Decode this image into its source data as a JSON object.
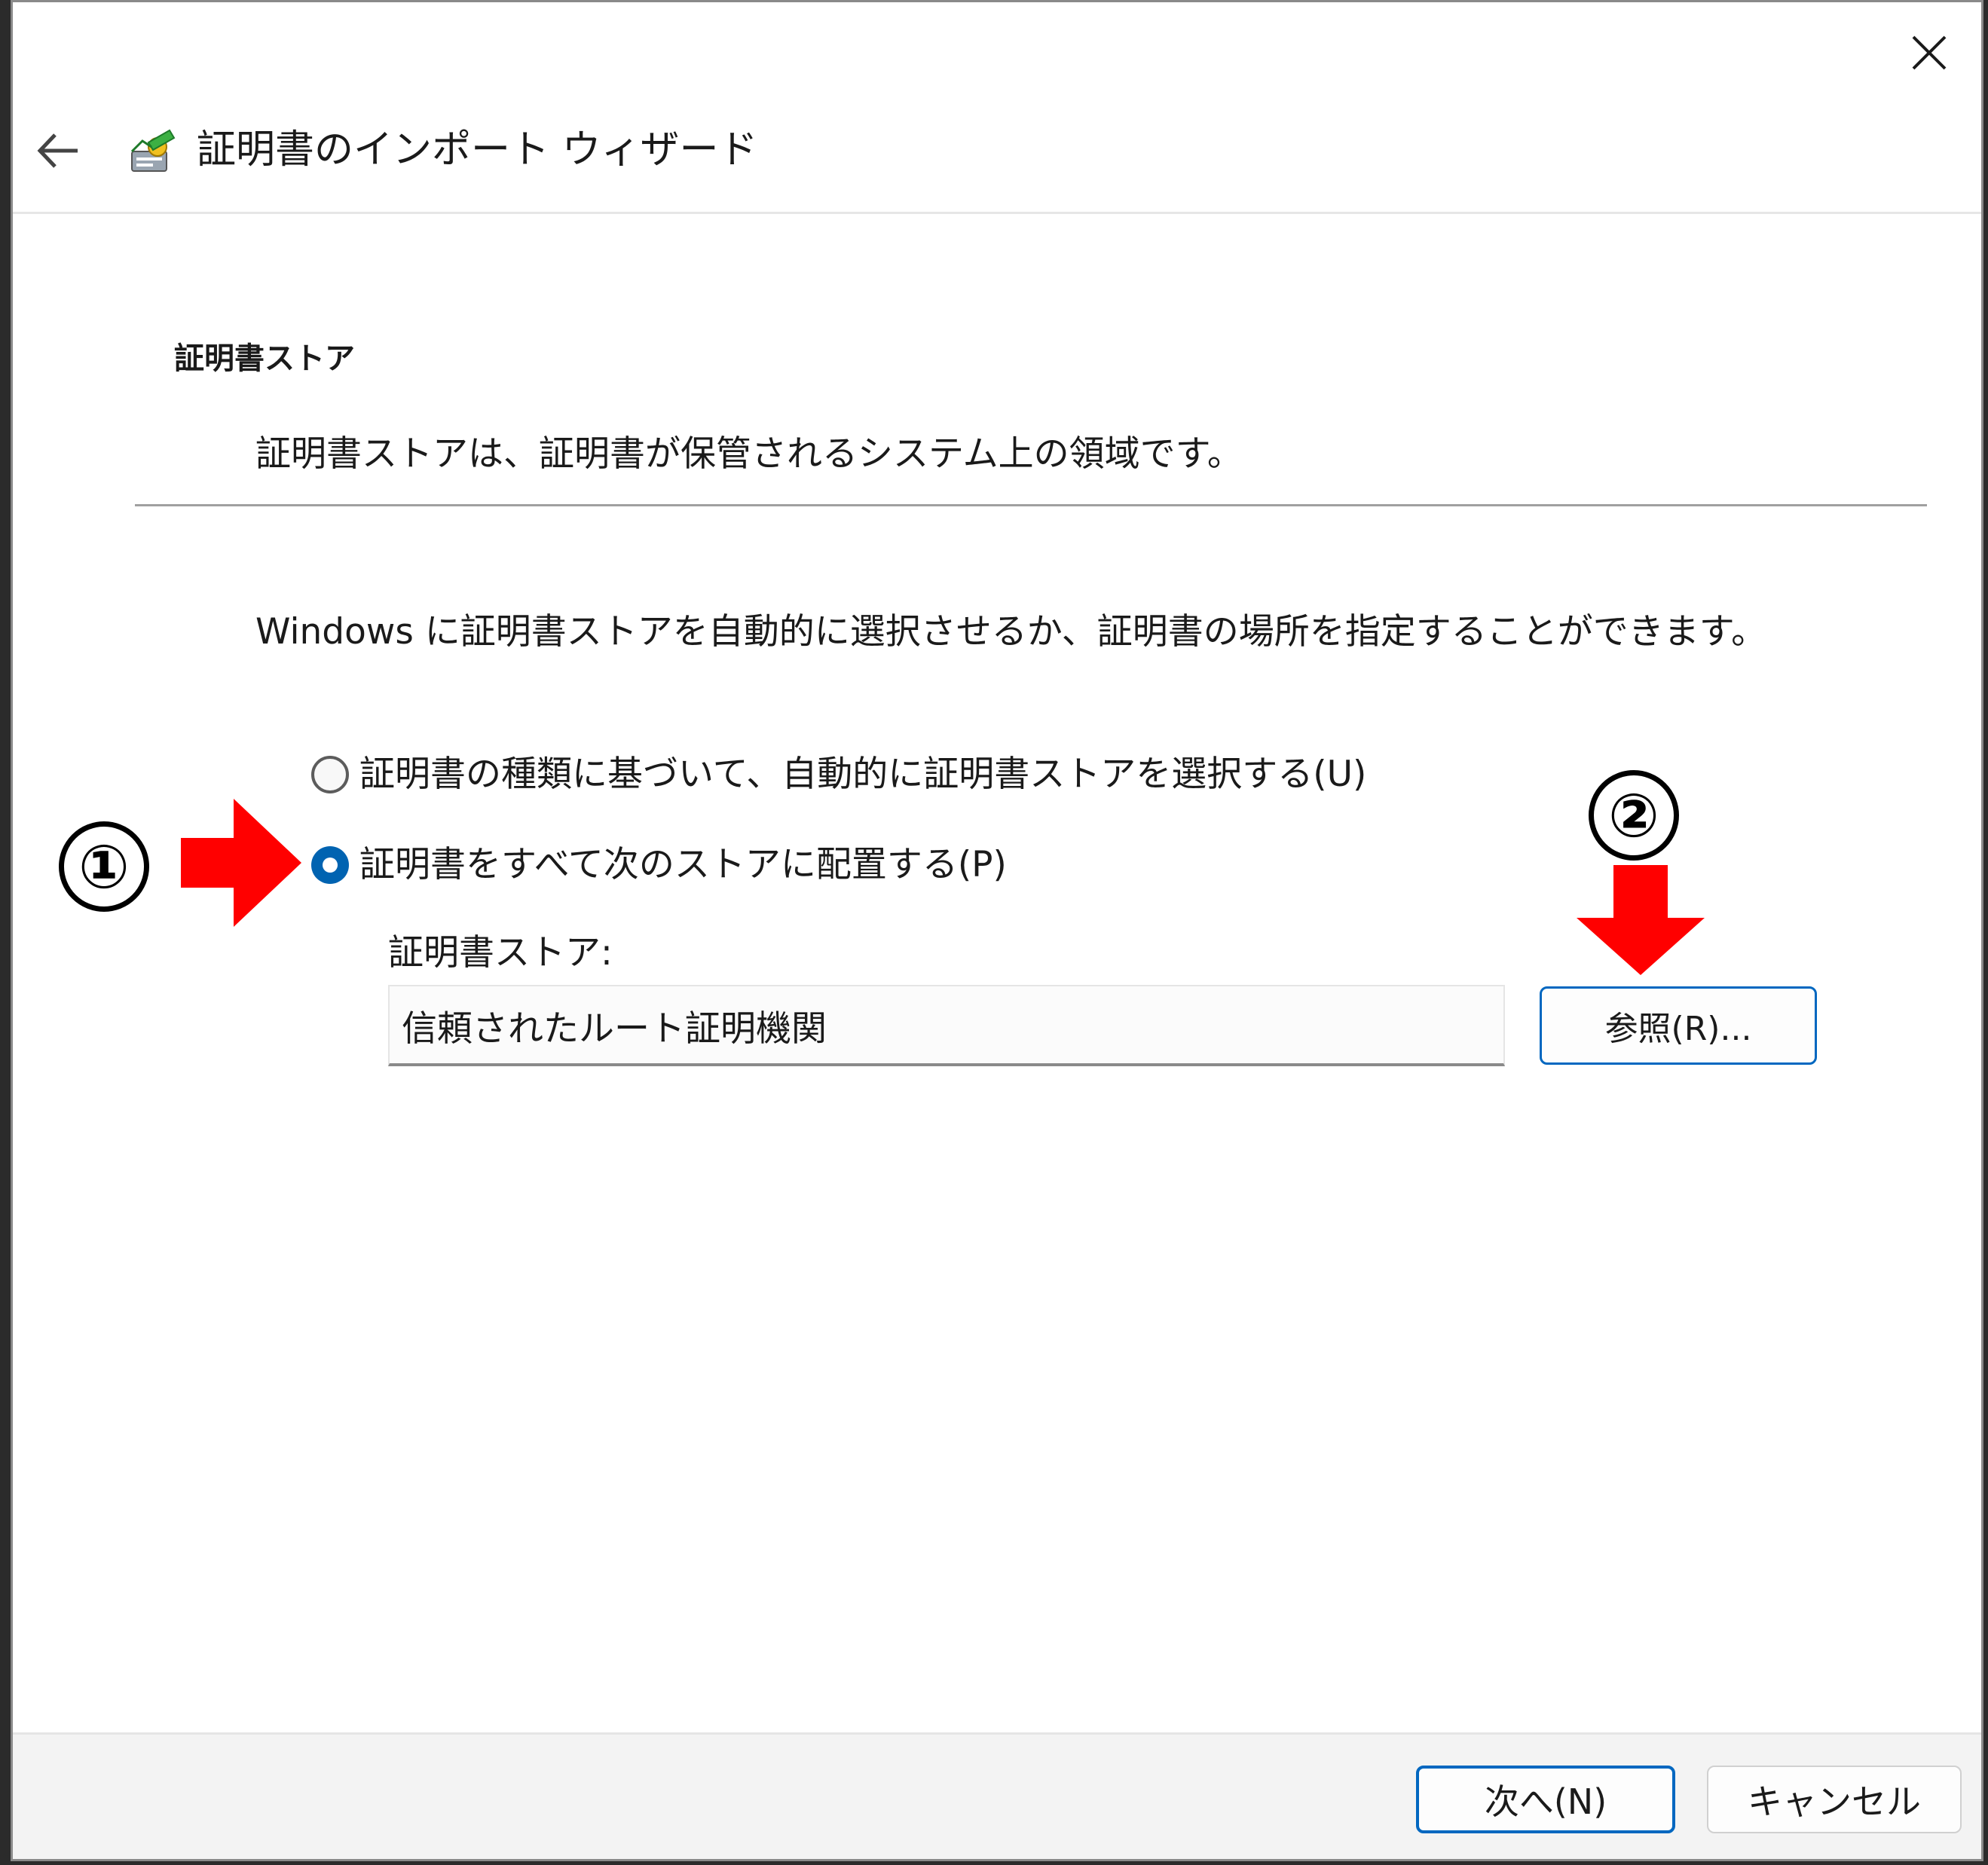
{
  "window": {
    "title": "証明書のインポート ウィザード",
    "close_icon": "close-icon",
    "back_icon": "back-arrow-icon",
    "wizard_icon": "certificate-wizard-icon"
  },
  "section": {
    "title": "証明書ストア",
    "description": "証明書ストアは、証明書が保管されるシステム上の領域です。"
  },
  "intro_text": "Windows に証明書ストアを自動的に選択させるか、証明書の場所を指定することができます。",
  "options": [
    {
      "label": "証明書の種類に基づいて、自動的に証明書ストアを選択する(U)",
      "selected": false
    },
    {
      "label": "証明書をすべて次のストアに配置する(P)",
      "selected": true
    }
  ],
  "store": {
    "label": "証明書ストア:",
    "value": "信頼されたルート証明機関",
    "browse_label": "参照(R)..."
  },
  "footer": {
    "next_label": "次へ(N)",
    "cancel_label": "キャンセル"
  },
  "annotations": {
    "step1": "①",
    "step2": "②",
    "arrow_color": "#ff0000"
  },
  "colors": {
    "accent": "#0067c0",
    "radio_selected": "#0063b1"
  }
}
